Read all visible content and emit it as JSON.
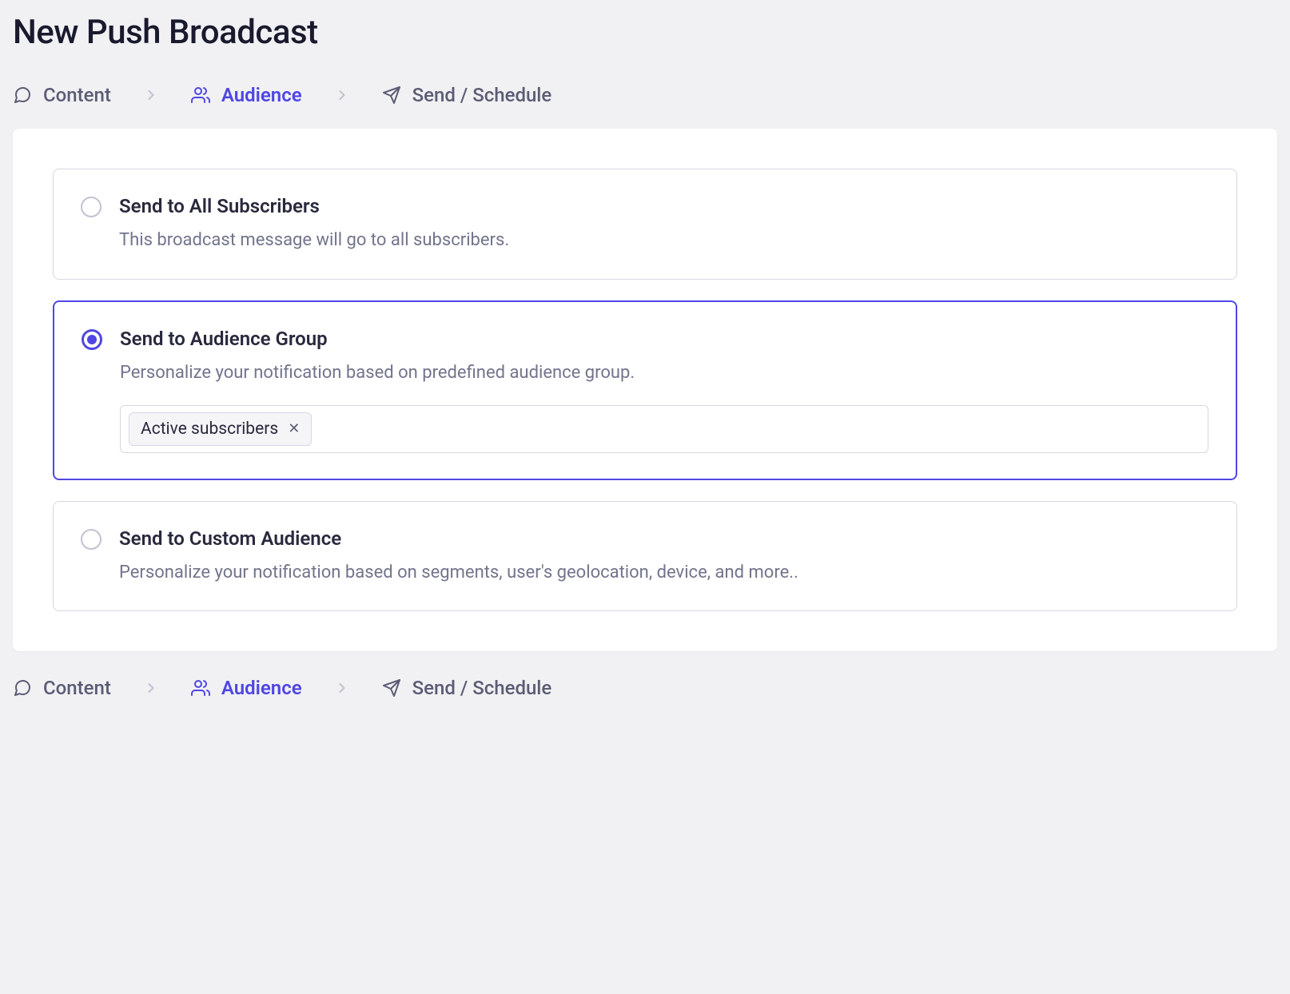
{
  "page": {
    "title": "New Push Broadcast"
  },
  "breadcrumb": {
    "items": [
      {
        "label": "Content",
        "icon": "message-icon",
        "active": false
      },
      {
        "label": "Audience",
        "icon": "people-icon",
        "active": true
      },
      {
        "label": "Send / Schedule",
        "icon": "send-icon",
        "active": false
      }
    ]
  },
  "options": {
    "all": {
      "title": "Send to All Subscribers",
      "desc": "This broadcast message will go to all subscribers.",
      "selected": false
    },
    "group": {
      "title": "Send to Audience Group",
      "desc": "Personalize your notification based on predefined audience group.",
      "selected": true,
      "tags": [
        {
          "label": "Active subscribers"
        }
      ]
    },
    "custom": {
      "title": "Send to Custom Audience",
      "desc": "Personalize your notification based on segments, user's geolocation, device, and more..",
      "selected": false
    }
  }
}
